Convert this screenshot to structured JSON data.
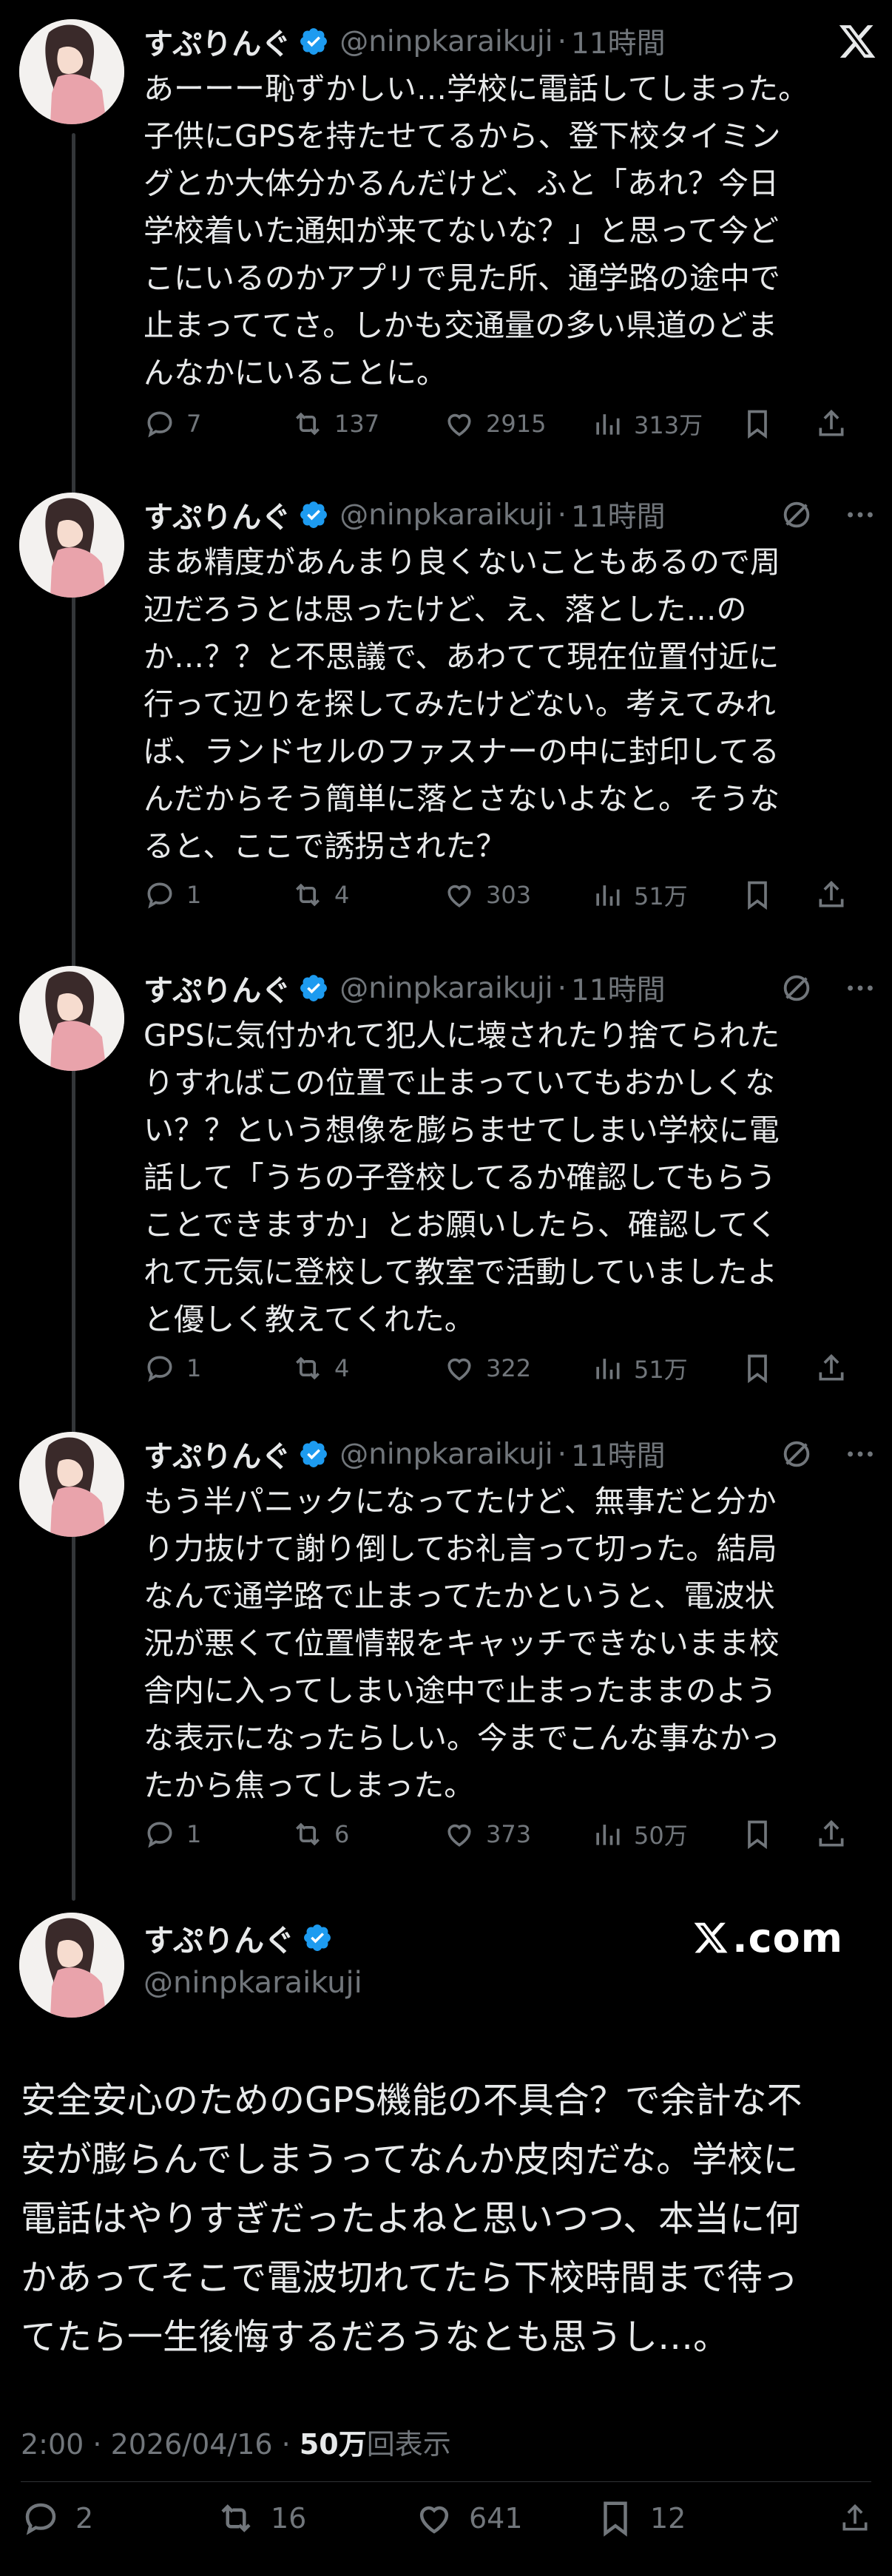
{
  "author": {
    "display_name": "すぷりんぐ",
    "handle": "@ninpkaraikuji"
  },
  "tweets": [
    {
      "time": "11時間",
      "text": "あーーー恥ずかしい…学校に電話してしまった。\n子供にGPSを持たせてるから、登下校タイミン\nグとか大体分かるんだけど、ふと「あれ？今日\n学校着いた通知が来てないな？」と思って今ど\nこにいるのかアプリで見た所、通学路の途中で\n止まっててさ。しかも交通量の多い県道のどま\nんなかにいることに。",
      "replies": "7",
      "retweets": "137",
      "likes": "2915",
      "views": "313万"
    },
    {
      "time": "11時間",
      "text": "まあ精度があんまり良くないこともあるので周\n辺だろうとは思ったけど、え、落とした…の\nか…？？と不思議で、あわてて現在位置付近に\n行って辺りを探してみたけどない。考えてみれ\nば、ランドセルのファスナーの中に封印してる\nんだからそう簡単に落とさないよなと。そうな\nると、ここで誘拐された？",
      "replies": "1",
      "retweets": "4",
      "likes": "303",
      "views": "51万"
    },
    {
      "time": "11時間",
      "text": "GPSに気付かれて犯人に壊されたり捨てられた\nりすればこの位置で止まっていてもおかしくな\nい？？という想像を膨らませてしまい学校に電\n話して「うちの子登校してるか確認してもらう\nことできますか」とお願いしたら、確認してく\nれて元気に登校して教室で活動していましたよ\nと優しく教えてくれた。",
      "replies": "1",
      "retweets": "4",
      "likes": "322",
      "views": "51万"
    },
    {
      "time": "11時間",
      "text": "もう半パニックになってたけど、無事だと分か\nり力抜けて謝り倒してお礼言って切った。結局\nなんで通学路で止まってたかというと、電波状\n況が悪くて位置情報をキャッチできないまま校\n舎内に入ってしまい途中で止まったままのよう\nな表示になったらしい。今までこんな事なかっ\nたから焦ってしまった。",
      "replies": "1",
      "retweets": "6",
      "likes": "373",
      "views": "50万"
    }
  ],
  "main_tweet": {
    "brand": ".com",
    "text": "安全安心のためのGPS機能の不具合？で余計な不\n安が膨らんでしまうってなんか皮肉だな。学校に\n電話はやりすぎだったよねと思いつつ、本当に何\nかあってそこで電波切れてたら下校時間まで待っ\nてたら一生後悔するだろうなとも思うし…。",
    "timestamp": "2:00 · 2026/04/16 · ",
    "views_count": "50万",
    "views_suffix": "回表示",
    "replies": "2",
    "retweets": "16",
    "likes": "641",
    "bookmarks": "12"
  },
  "icons": {
    "verified": "verified-badge-icon",
    "x": "x-logo-icon",
    "grok": "grok-icon",
    "more": "more-icon",
    "reply": "reply-icon",
    "retweet": "retweet-icon",
    "like": "heart-icon",
    "views": "views-icon",
    "bookmark": "bookmark-icon",
    "share": "share-icon"
  },
  "colors": {
    "background": "#000000",
    "text": "#e7e9ea",
    "muted": "#71767b",
    "verified": "#1d9bf0",
    "thread_line": "#333639"
  }
}
